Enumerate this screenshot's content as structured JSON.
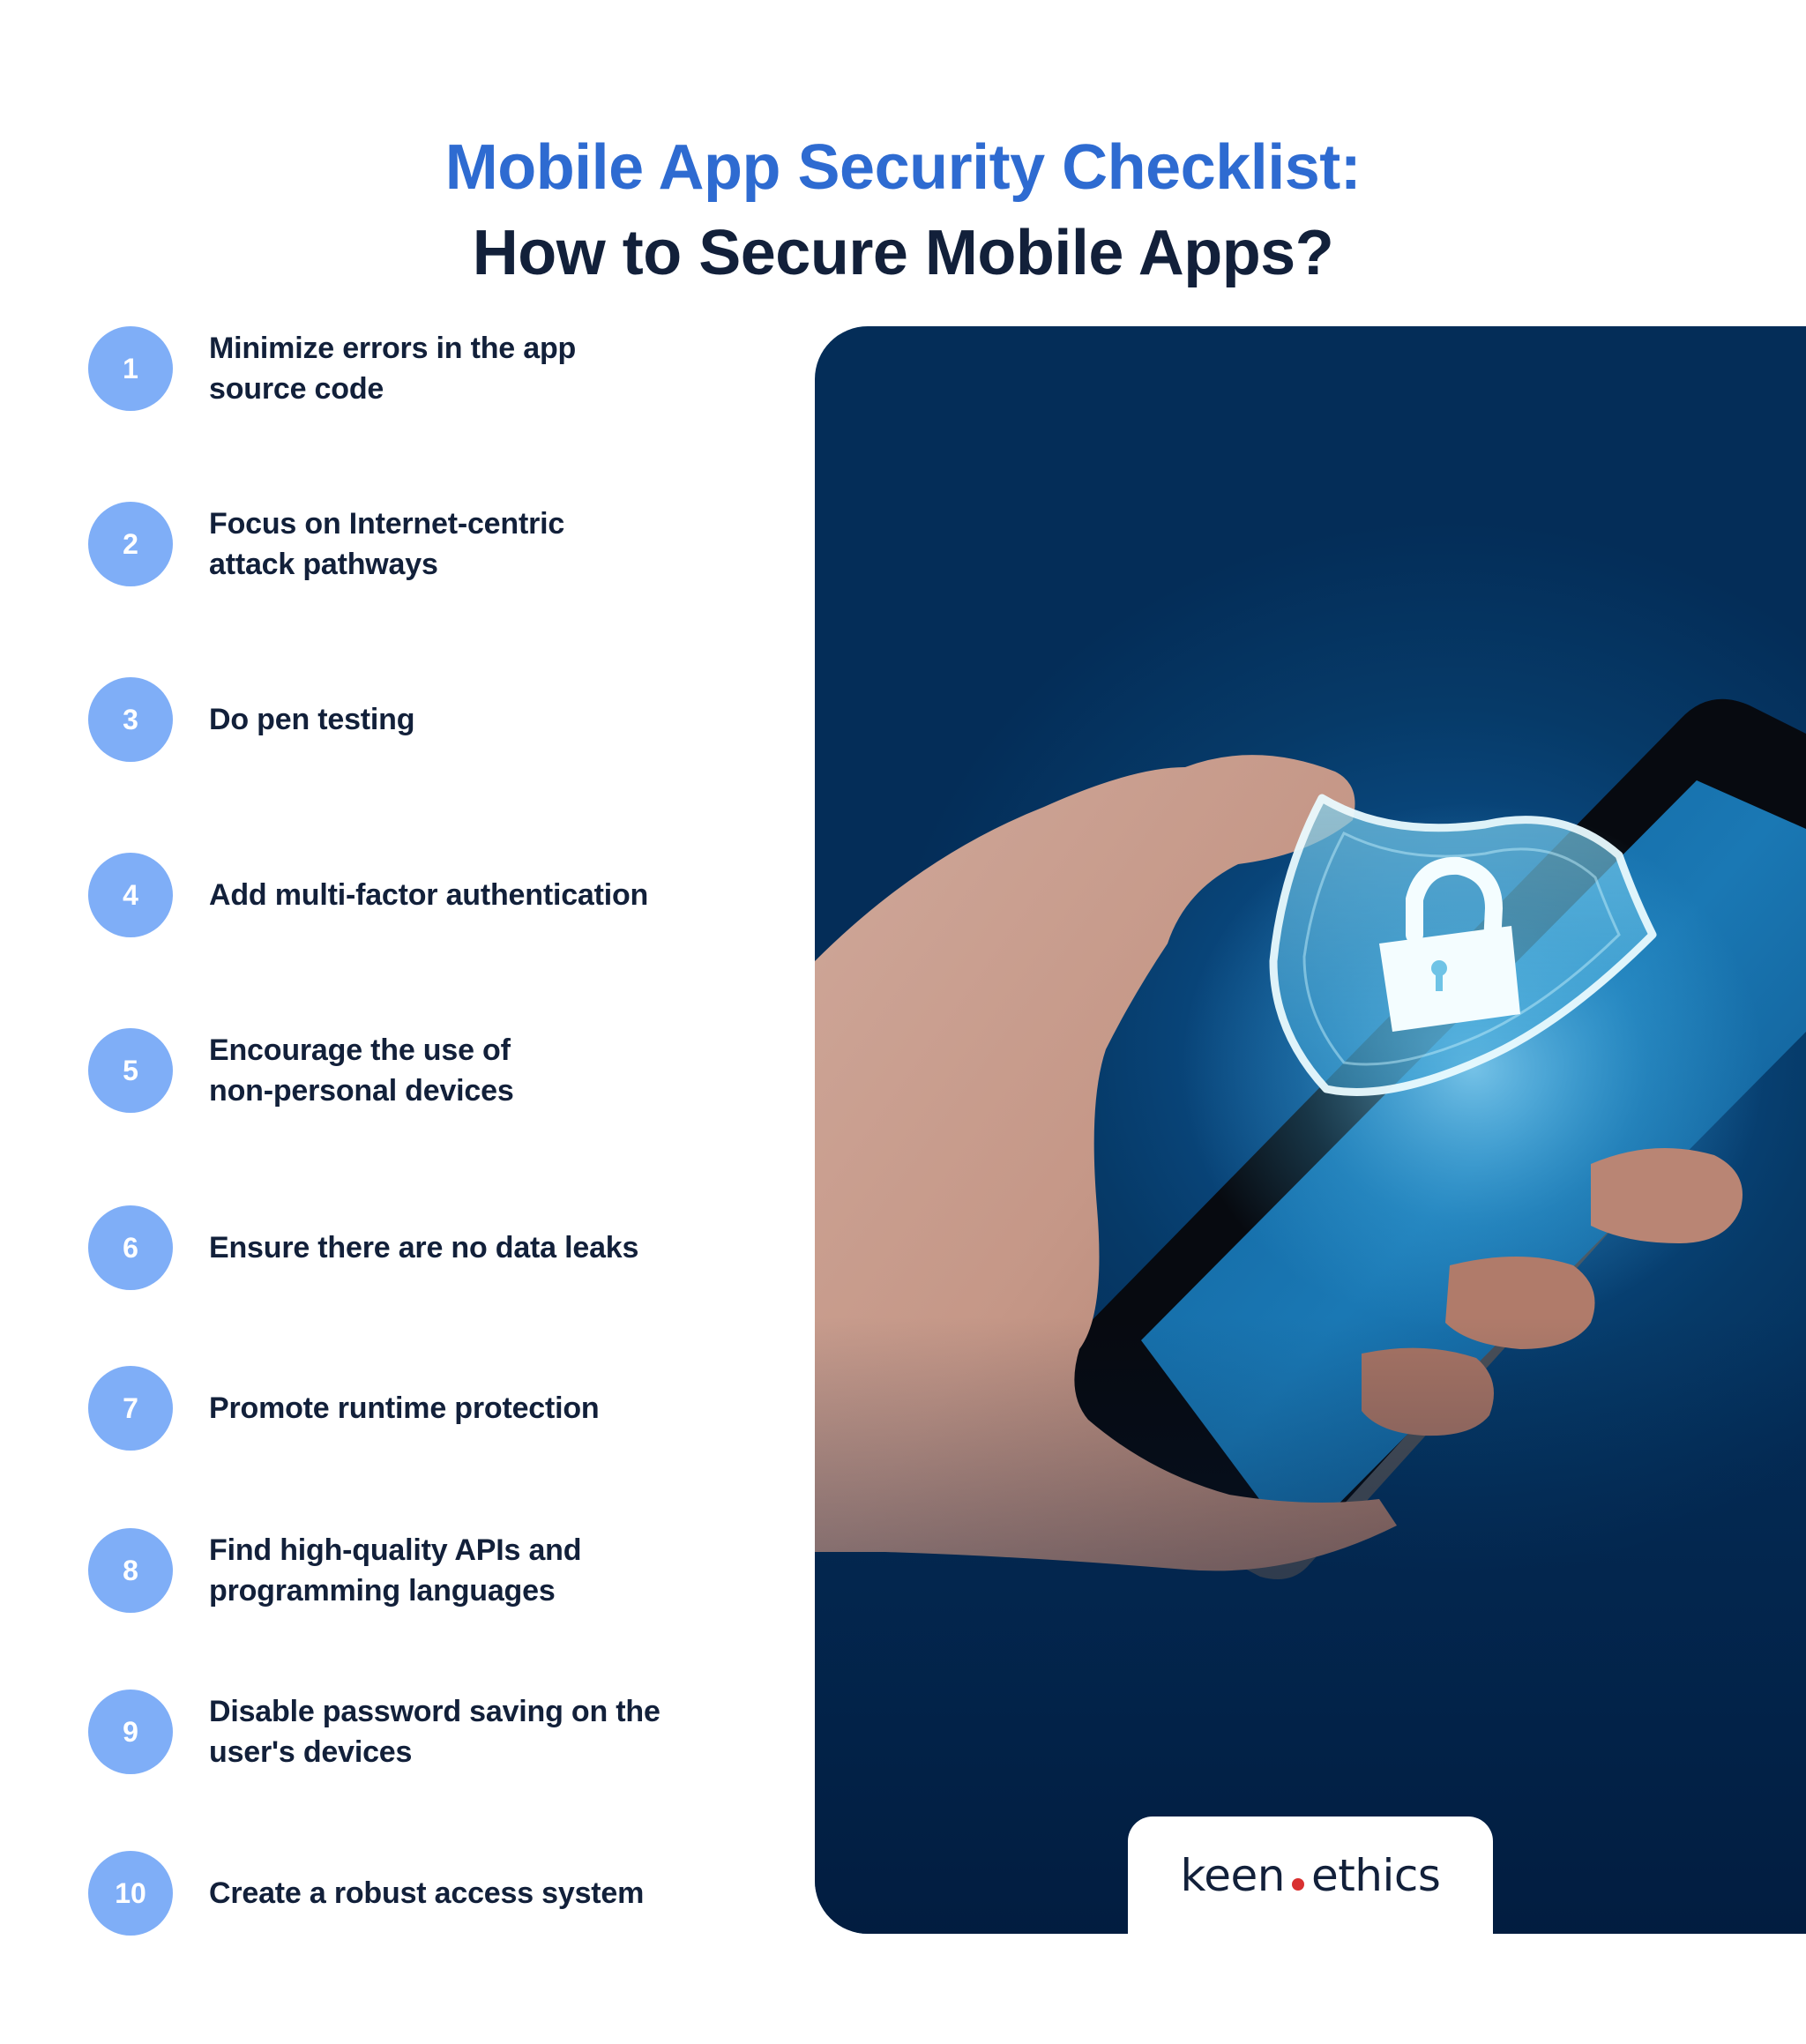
{
  "header": {
    "title_line1": "Mobile App Security Checklist:",
    "title_line2": "How to Secure Mobile Apps?"
  },
  "checklist": {
    "items": [
      {
        "number": "1",
        "label": "Minimize errors in the app\nsource code"
      },
      {
        "number": "2",
        "label": "Focus on Internet-centric\nattack pathways"
      },
      {
        "number": "3",
        "label": "Do pen testing"
      },
      {
        "number": "4",
        "label": "Add multi-factor authentication"
      },
      {
        "number": "5",
        "label": "Encourage the use of\nnon-personal devices"
      },
      {
        "number": "6",
        "label": "Ensure there are no data leaks"
      },
      {
        "number": "7",
        "label": "Promote runtime protection"
      },
      {
        "number": "8",
        "label": "Find high-quality APIs and\nprogramming languages"
      },
      {
        "number": "9",
        "label": "Disable password saving on the\nuser's devices"
      },
      {
        "number": "10",
        "label": "Create a robust access system"
      }
    ]
  },
  "illustration": {
    "description": "hand holding smartphone with glowing shield and padlock",
    "icons": [
      "shield-icon",
      "padlock-icon"
    ]
  },
  "brand": {
    "name_part1": "keen",
    "name_part2": "ethics",
    "dot_color": "#D93030"
  },
  "colors": {
    "title_accent": "#2E6BD1",
    "text_dark": "#12203A",
    "number_badge": "#7FAEF7",
    "panel_bg": "#03335E"
  }
}
